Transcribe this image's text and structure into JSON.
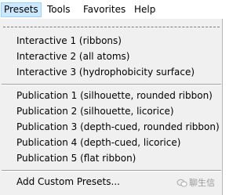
{
  "menubar": {
    "items": [
      {
        "label": "Presets",
        "active": true
      },
      {
        "label": "Tools",
        "active": false
      },
      {
        "label": "Favorites",
        "active": false
      },
      {
        "label": "Help",
        "active": false
      }
    ]
  },
  "menu": {
    "items": [
      "Interactive 1 (ribbons)",
      "Interactive 2 (all atoms)",
      "Interactive 3 (hydrophobicity surface)",
      "Publication 1 (silhouette, rounded ribbon)",
      "Publication 2 (silhouette, licorice)",
      "Publication 3 (depth-cued, rounded ribbon)",
      "Publication 4 (depth-cued, licorice)",
      "Publication 5 (flat ribbon)",
      "Add Custom Presets..."
    ]
  },
  "watermark": {
    "icon": "chat-bubble-icon",
    "text": "聊生信"
  },
  "colors": {
    "active_menu_bg": "#cce8ff",
    "active_menu_border": "#99d1ff",
    "menu_bg": "#f0f0f0"
  }
}
